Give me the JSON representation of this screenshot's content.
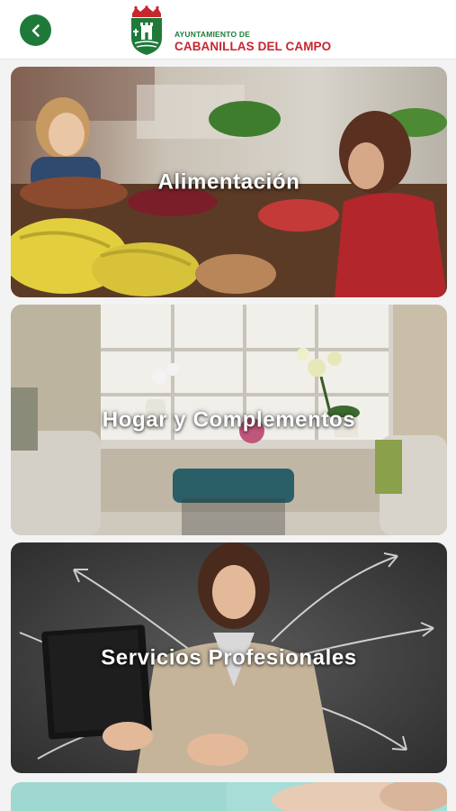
{
  "header": {
    "back_icon": "chevron-left-icon",
    "logo": {
      "line1": "AYUNTAMIENTO DE",
      "line2": "CABANILLAS DEL CAMPO"
    }
  },
  "categories": [
    {
      "title": "Alimentación"
    },
    {
      "title": "Hogar y Complementos"
    },
    {
      "title": "Servicios Profesionales"
    },
    {
      "title": ""
    }
  ],
  "colors": {
    "brand_green": "#1f7a3a",
    "brand_red": "#c8262e",
    "background": "#f3f3f3"
  }
}
